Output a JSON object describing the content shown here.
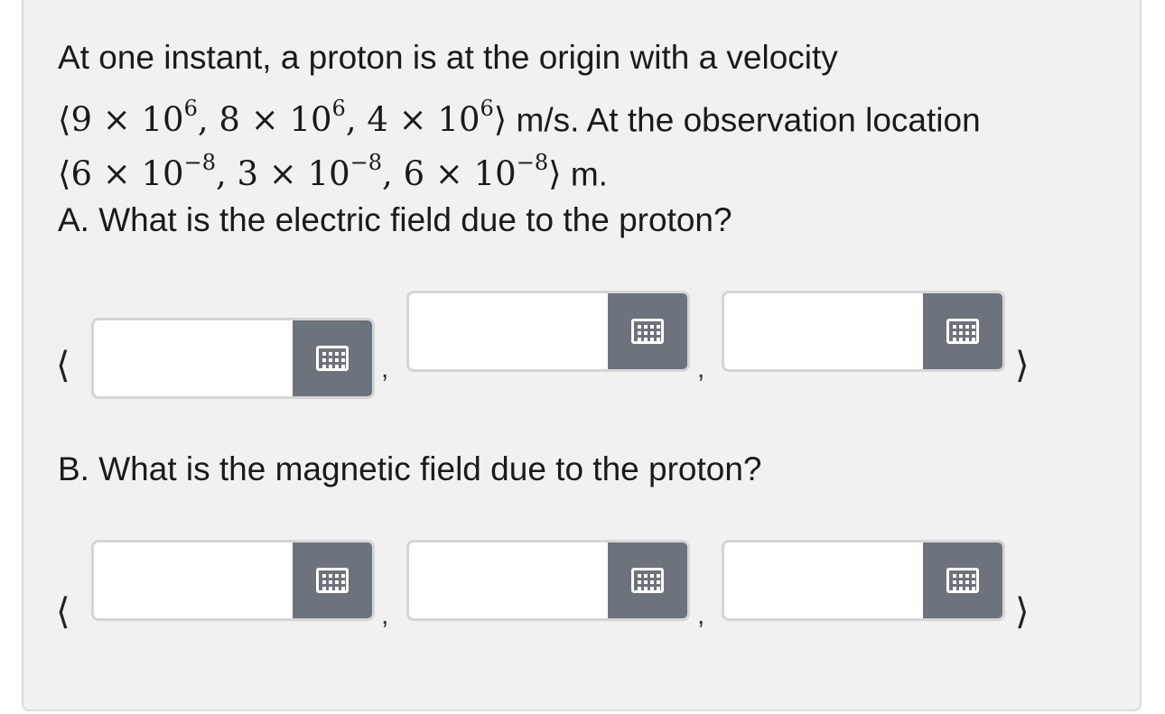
{
  "problem": {
    "line1": "At one instant, a proton is at the origin with a velocity",
    "velocity": {
      "open": "⟨",
      "c1_base": "9 × 10",
      "c1_exp": "6",
      "c2_base": ", 8 × 10",
      "c2_exp": "6",
      "c3_base": ", 4 × 10",
      "c3_exp": "6",
      "close": "⟩"
    },
    "line2_suffix": " m/s. At the observation location",
    "location": {
      "open": "⟨",
      "c1_base": "6 × 10",
      "c1_exp": "−8",
      "c2_base": ", 3 × 10",
      "c2_exp": "−8",
      "c3_base": ", 6 × 10",
      "c3_exp": "−8",
      "close": "⟩"
    },
    "line3_suffix": " m."
  },
  "part_a": {
    "question": "A. What is the electric field due to the proton?",
    "open_bracket": "⟨",
    "close_bracket": "⟩",
    "comma": ",",
    "inputs": [
      {
        "value": "",
        "keyboard_icon": "keyboard-icon"
      },
      {
        "value": "",
        "keyboard_icon": "keyboard-icon"
      },
      {
        "value": "",
        "keyboard_icon": "keyboard-icon"
      }
    ]
  },
  "part_b": {
    "question": "B. What is the magnetic field due to the proton?",
    "open_bracket": "⟨",
    "close_bracket": "⟩",
    "comma": ",",
    "inputs": [
      {
        "value": "",
        "keyboard_icon": "keyboard-icon"
      },
      {
        "value": "",
        "keyboard_icon": "keyboard-icon"
      },
      {
        "value": "",
        "keyboard_icon": "keyboard-icon"
      }
    ]
  },
  "colors": {
    "panel_bg": "#f1f1f1",
    "keyboard_button": "#6c737c",
    "input_border": "#d5d5d5"
  }
}
